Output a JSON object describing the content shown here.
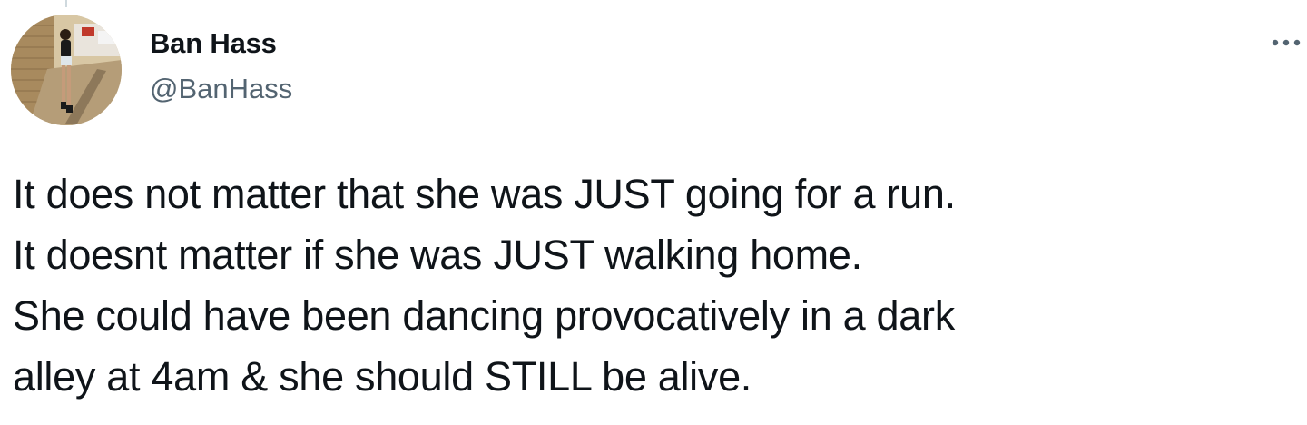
{
  "tweet": {
    "author": {
      "display_name": "Ban Hass",
      "handle": "@BanHass",
      "avatar": "profile-photo"
    },
    "more_icon": "more-horizontal-icon",
    "text_lines": [
      "It does not matter that she was JUST going for a run.",
      "It doesnt matter if she was JUST walking home.",
      "She could have been dancing provocatively in a dark",
      "alley at 4am & she should STILL be alive."
    ]
  },
  "colors": {
    "text": "#0f1419",
    "secondary": "#536471",
    "background": "#ffffff"
  }
}
